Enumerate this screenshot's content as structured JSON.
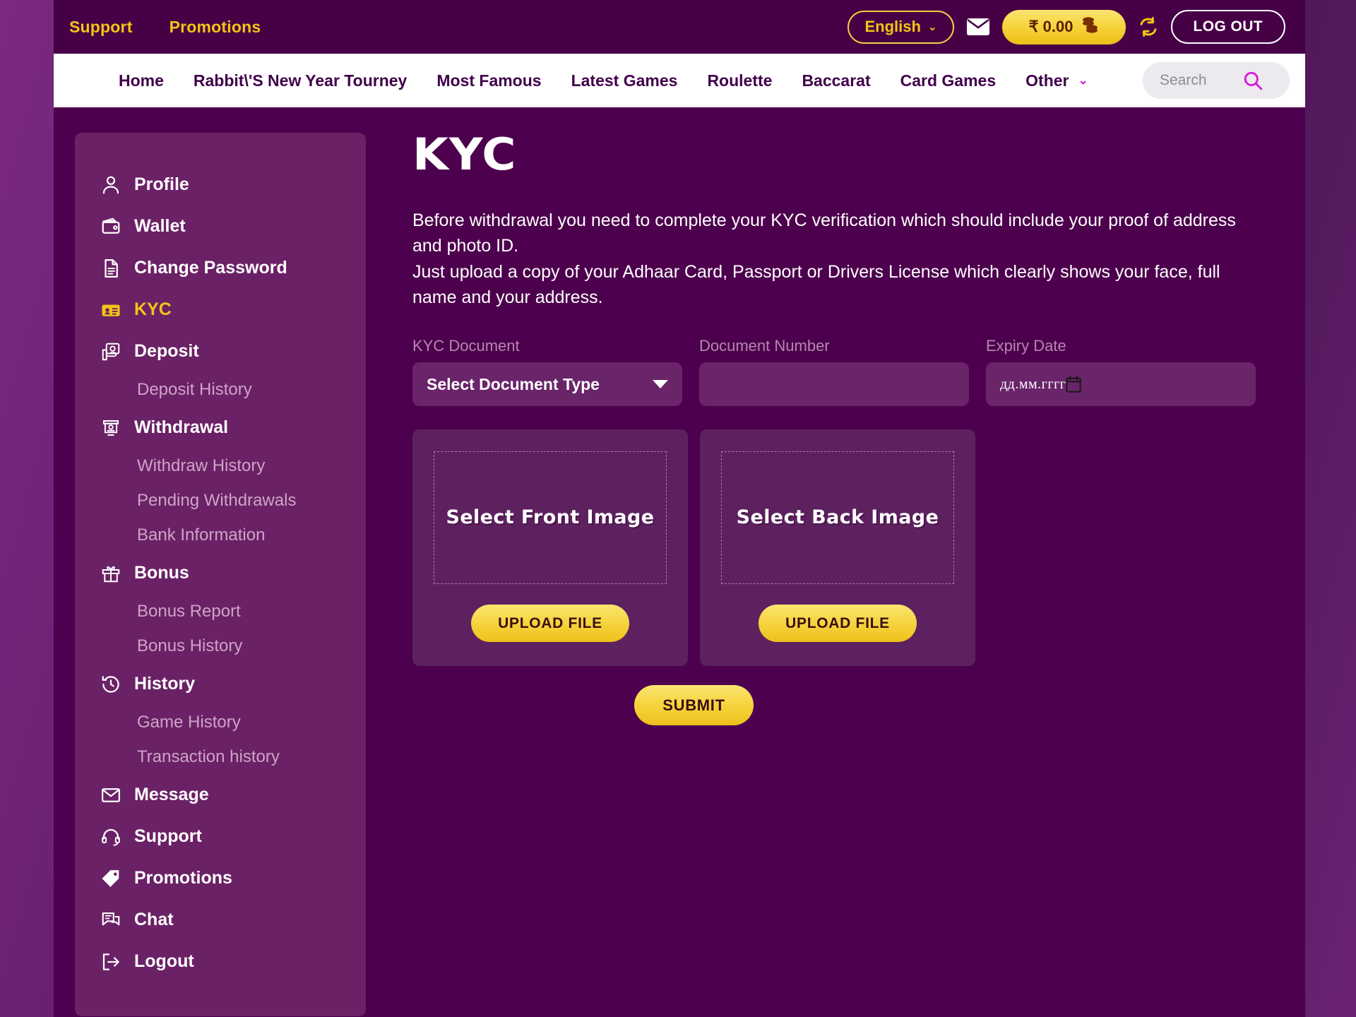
{
  "topbar": {
    "links": [
      {
        "label": "Support"
      },
      {
        "label": "Promotions"
      }
    ],
    "language": "English",
    "balance": "₹ 0.00",
    "logout_label": "LOG OUT",
    "icons": {
      "mail": "mail-icon",
      "refresh": "refresh-icon",
      "chevron": "⌄"
    }
  },
  "nav": {
    "items": [
      {
        "label": "Home"
      },
      {
        "label": "Rabbit\\'S New Year Tourney"
      },
      {
        "label": "Most Famous"
      },
      {
        "label": "Latest Games"
      },
      {
        "label": "Roulette"
      },
      {
        "label": "Baccarat"
      },
      {
        "label": "Card Games"
      },
      {
        "label": "Other",
        "has_chevron": true
      }
    ],
    "chevron": "⌄",
    "search": {
      "placeholder": "Search",
      "value": ""
    }
  },
  "sidebar": {
    "items": [
      {
        "label": "Profile",
        "icon": "user-icon",
        "type": "main",
        "active": false
      },
      {
        "label": "Wallet",
        "icon": "wallet-icon",
        "type": "main",
        "active": false
      },
      {
        "label": "Change Password",
        "icon": "document-icon",
        "type": "main",
        "active": false
      },
      {
        "label": "KYC",
        "icon": "id-card-icon",
        "type": "main",
        "active": true
      },
      {
        "label": "Deposit",
        "icon": "deposit-money-icon",
        "type": "main",
        "active": false
      },
      {
        "label": "Deposit History",
        "icon": "",
        "type": "sub",
        "active": false
      },
      {
        "label": "Withdrawal",
        "icon": "atm-icon",
        "type": "main",
        "active": false
      },
      {
        "label": "Withdraw History",
        "icon": "",
        "type": "sub",
        "active": false
      },
      {
        "label": "Pending Withdrawals",
        "icon": "",
        "type": "sub",
        "active": false
      },
      {
        "label": "Bank Information",
        "icon": "",
        "type": "sub",
        "active": false
      },
      {
        "label": "Bonus",
        "icon": "gift-icon",
        "type": "main",
        "active": false
      },
      {
        "label": "Bonus Report",
        "icon": "",
        "type": "sub",
        "active": false
      },
      {
        "label": "Bonus History",
        "icon": "",
        "type": "sub",
        "active": false
      },
      {
        "label": "History",
        "icon": "clock-history-icon",
        "type": "main",
        "active": false
      },
      {
        "label": "Game History",
        "icon": "",
        "type": "sub",
        "active": false
      },
      {
        "label": "Transaction history",
        "icon": "",
        "type": "sub",
        "active": false
      },
      {
        "label": "Message",
        "icon": "envelope-icon",
        "type": "main",
        "active": false
      },
      {
        "label": "Support",
        "icon": "headset-icon",
        "type": "main",
        "active": false
      },
      {
        "label": "Promotions",
        "icon": "tag-icon",
        "type": "main",
        "active": false
      },
      {
        "label": "Chat",
        "icon": "chat-bubble-icon",
        "type": "main",
        "active": false
      },
      {
        "label": "Logout",
        "icon": "logout-arrow-icon",
        "type": "main",
        "active": false
      }
    ]
  },
  "main": {
    "title": "KYC",
    "description_line1": "Before withdrawal you need to complete your KYC verification which should include your proof of address and photo ID.",
    "description_line2": "Just upload a copy of your Adhaar Card, Passport or Drivers License which clearly shows your face, full name and your address.",
    "fields": {
      "kyc_document": {
        "label": "KYC Document",
        "selected": "Select Document Type"
      },
      "document_number": {
        "label": "Document Number",
        "value": "",
        "placeholder": ""
      },
      "expiry_date": {
        "label": "Expiry Date",
        "placeholder": "дд.мм.гггг",
        "value": ""
      }
    },
    "uploads": [
      {
        "dropzone_label": "Select Front Image",
        "button_label": "UPLOAD FILE"
      },
      {
        "dropzone_label": "Select Back Image",
        "button_label": "UPLOAD FILE"
      }
    ],
    "submit_label": "SUBMIT"
  },
  "colors": {
    "page_bg": "#4d004d",
    "topbar_bg": "#460046",
    "sidebar_bg": "#6b2166",
    "card_bg": "#5e2160",
    "accent_yellow": "#f3c515",
    "accent_magenta": "#d916d9",
    "nav_bg": "#ffffff",
    "muted_text": "#cda4c7"
  }
}
